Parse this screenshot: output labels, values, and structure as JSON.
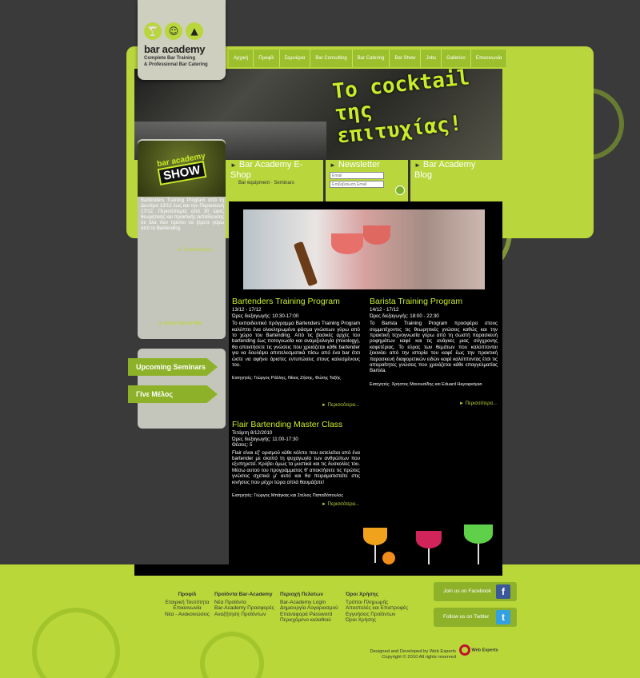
{
  "logo": {
    "title": "bar academy",
    "subtitle1": "Complete Bar Training",
    "subtitle2": "& Professional Bar Catering"
  },
  "nav": [
    "Αρχική",
    "Προφίλ",
    "Σεμινάρια",
    "Bar Consulting",
    "Bar Catering",
    "Bar Show",
    "Jobs",
    "Galleries",
    "Επικοινωνία"
  ],
  "banner": {
    "slogan": "Το cocktail της επιτυχίας!"
  },
  "show": {
    "line1": "bar academy",
    "line2": "SHOW",
    "text": "Bartenders Training Program από τη Δευτέρα 13/12 έως και την Παρασκευή 17/12. Περισσότερες από 30 ώρες θεωρητικής και πρακτικής εκπαίδευσης σε όλα που πρέπει να ξέρετε γύρω από το Bartending.",
    "more": "Περισσότερα...",
    "seeall": "Δείτε όλα τα Νέα"
  },
  "promo": {
    "eshop_title": "Bar Academy E-Shop",
    "eshop_sub": "Bar equipment · Seminars",
    "newsletter_title": "Newsletter",
    "email_placeholder": "Email",
    "confirm_placeholder": "Επιβεβαίωση Email",
    "blog_title": "Bar Academy Blog"
  },
  "sidebar": {
    "upcoming": "Upcoming Seminars",
    "member": "Γίνε Μέλος"
  },
  "articles": [
    {
      "title": "Bartenders Training Program",
      "dates": "13/12 - 17/12",
      "time": "Ώρες διεξαγωγής: 10:30-17:00",
      "body": "Το εκπαιδευτικό πρόγραμμα Bartenders Training Program καλύπτει ένα ολοκληρωμένο φάσμα γνώσεων γύρω από το χώρο του Bartending. Από τις βασικές αρχές του bartending έως ποτογνωσία και αναμιξιολογία (mixology), θα αποκτήσετε τις γνώσεις που χρειάζεται κάθε bartender για να δουλέψει αποτελεσματικά πίσω από ένα bar έτσι ώστε να αφήνει άριστες εντυπώσεις στους καλεσμένους του.",
      "tutors": "Εισηγητές: Γιώργος Ράλλης, Νίκος Ζήσης, Φώτης Ταξής",
      "more": "Περισσότερα..."
    },
    {
      "title": "Barista Training Program",
      "dates": "14/12 - 17/12",
      "time": "Ώρες διεξαγωγής: 18:00 - 22:30",
      "body": "Το Barista Training Program προσφέρει στους συμμετέχοντες τις θεωρητικές γνώσεις καθώς και την πρακτική τεχνογνωσία γύρω από τη σωστή παρασκευή ροφημάτων καφέ και τις ανάγκες μιας σύγχρονης καφετέριας. Το εύρος των θεμάτων που καλύπτονται ξεκινάει από την ιστορία του καφέ έως την πρακτική παρασκευή διαφορετικών ειδών καφέ καλύπτοντας έτσι τις απαραίτητες γνώσεις που χρειάζεται κάθε επαγγελματίας Barista.",
      "tutors": "Εισηγητές: Χρήστος Μανουσίδης και Eduard Hayrapetyan",
      "more": "Περισσότερα..."
    },
    {
      "title": "Flair Bartending Master Class",
      "dates": "Τετάρτη 8/12/2010",
      "time": "Ώρες διεξαγωγής: 11:00-17:30",
      "seats": "Θέσεις: 5",
      "body": "Flair είναι εξ' ορισμού κάθε κόλπο που εκτελείται από ένα bartender με σκοπό τη ψυχαγωγία των ανθρώπων που εξυπηρετεί. Κρύβει όμως τα μυστικά και τις δυσκολίες του. Μέσω αυτού του προγράμματος θ' αποκτήσετε τις πρώτες γνώσεις σχετικά μ' αυτό και θα πειραματιστείτε στις κινήσεις που μέχρι τώρα απλά θαυμάζατε!",
      "tutors": "Εισηγητές: Γιώργος Μπάγκας και Στέλιος Παπαδόπουλος",
      "more": "Περισσότερα..."
    }
  ],
  "footer": {
    "columns": [
      {
        "title": "Προφίλ",
        "items": [
          "Εταιρική Ταυτότητα",
          "Επικοινωνία",
          "Νέα - Ανακοινώσεις"
        ]
      },
      {
        "title": "Προϊόντα Bar-Academy",
        "items": [
          "Νέα Προϊόντα",
          "Bar-Academy Προσφορές",
          "Αναζήτηση Προϊόντων"
        ]
      },
      {
        "title": "Περιοχή Πελατών",
        "items": [
          "Bar-Academy Login",
          "Δημιουργία Λογαριασμού",
          "Επαναφορά Password",
          "Περιεχόμενο καλαθιού"
        ]
      },
      {
        "title": "Όροι Χρήσης",
        "items": [
          "Τρόποι Πληρωμής",
          "Αποστολές και Επιστροφές",
          "Εγγυήσεις Προϊόντων",
          "Όροι Χρήσης"
        ]
      }
    ],
    "facebook": "Join us on Facebook",
    "twitter": "Follow us on Twitter",
    "credit1": "Designed and Developed by Web Experts",
    "credit2": "Copyright © 2010 All rights reserved",
    "we_logo": "Web Experts"
  },
  "colors": {
    "lime": "#b9d63c",
    "dark": "#3a3a3a",
    "accent": "#c8ec2a"
  }
}
